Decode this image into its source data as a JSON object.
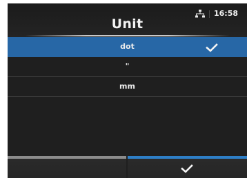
{
  "header": {
    "title": "Unit",
    "clock": "16:58",
    "network_icon": "network-icon"
  },
  "units": {
    "options": [
      {
        "label": "dot",
        "selected": true
      },
      {
        "label": "\"",
        "selected": false
      },
      {
        "label": "mm",
        "selected": false
      }
    ],
    "selected_icon": "check-icon"
  },
  "footer": {
    "ok_icon": "check-icon"
  },
  "colors": {
    "selection": "#2767a6",
    "ok_accent": "#2e7fc7",
    "back_accent": "#8c8c8c",
    "background": "#1f1f1f"
  }
}
